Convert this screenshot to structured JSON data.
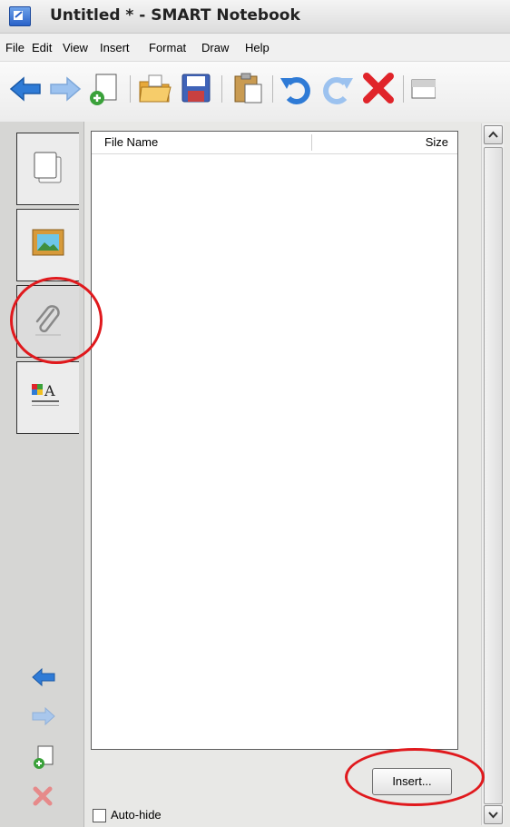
{
  "window": {
    "title": "Untitled * - SMART Notebook"
  },
  "menu": {
    "items": [
      "File",
      "Edit",
      "View",
      "Insert",
      "Format",
      "Draw",
      "Help"
    ]
  },
  "toolbar": {
    "buttons": [
      {
        "name": "back-arrow-icon"
      },
      {
        "name": "forward-arrow-icon"
      },
      {
        "name": "add-page-icon"
      },
      {
        "name": "open-folder-icon"
      },
      {
        "name": "save-icon"
      },
      {
        "name": "paste-icon"
      },
      {
        "name": "undo-icon"
      },
      {
        "name": "redo-icon"
      },
      {
        "name": "delete-icon"
      },
      {
        "name": "screen-shade-icon"
      }
    ],
    "colors": {
      "arrow": "#2f7bd6",
      "delete": "#e0242a",
      "folder": "#e7a93a"
    }
  },
  "side_tabs": [
    {
      "name": "page-sorter-icon"
    },
    {
      "name": "gallery-icon"
    },
    {
      "name": "attachments-icon"
    },
    {
      "name": "properties-icon"
    }
  ],
  "attachments": {
    "columns": {
      "name": "File Name",
      "size": "Size"
    },
    "rows": [],
    "insert_label": "Insert...",
    "autohide_label": "Auto-hide",
    "autohide_checked": false
  },
  "annotations": {
    "highlight_color": "#e0191d"
  }
}
